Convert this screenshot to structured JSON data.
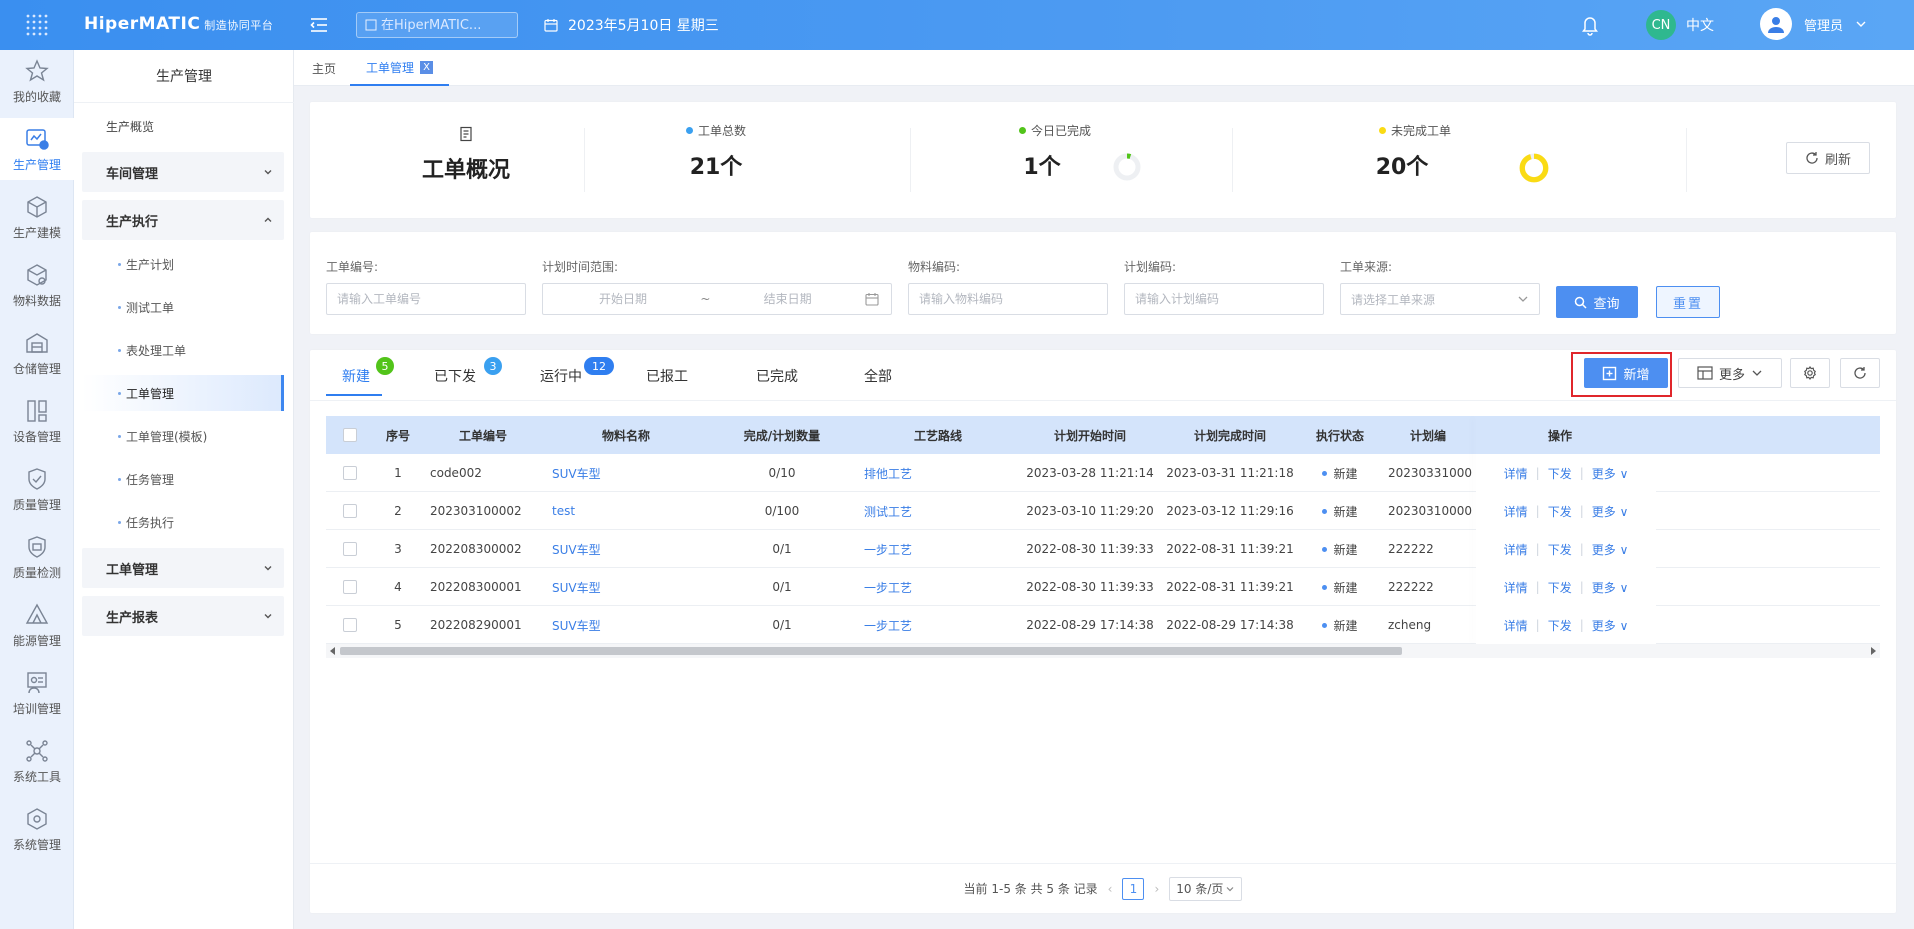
{
  "header": {
    "logo": "HiperMATIC",
    "logo_sub": "制造协同平台",
    "search_placeholder": "在HiperMATIC...",
    "date": "2023年5月10日 星期三",
    "lang_badge": "CN",
    "lang_label": "中文",
    "user_name": "管理员"
  },
  "rail": {
    "items": [
      {
        "label": "我的收藏",
        "icon": "star-icon"
      },
      {
        "label": "生产管理",
        "icon": "production-icon"
      },
      {
        "label": "生产建模",
        "icon": "cube-icon"
      },
      {
        "label": "物料数据",
        "icon": "cube-data-icon"
      },
      {
        "label": "仓储管理",
        "icon": "warehouse-icon"
      },
      {
        "label": "设备管理",
        "icon": "device-icon"
      },
      {
        "label": "质量管理",
        "icon": "shield-icon"
      },
      {
        "label": "质量检测",
        "icon": "shield-check-icon"
      },
      {
        "label": "能源管理",
        "icon": "energy-icon"
      },
      {
        "label": "培训管理",
        "icon": "training-icon"
      },
      {
        "label": "系统工具",
        "icon": "network-icon"
      },
      {
        "label": "系统管理",
        "icon": "settings-cube-icon"
      }
    ]
  },
  "submenu": {
    "title": "生产管理",
    "overview": "生产概览",
    "groups": {
      "workshop": "车间管理",
      "execution": "生产执行",
      "workorder": "工单管理",
      "report": "生产报表"
    },
    "exec_items": [
      "生产计划",
      "测试工单",
      "表处理工单",
      "工单管理",
      "工单管理(模板)",
      "任务管理",
      "任务执行"
    ]
  },
  "pagetabs": {
    "home": "主页",
    "current": "工单管理",
    "close": "X"
  },
  "overview": {
    "title": "工单概况",
    "total_label": "工单总数",
    "total_value": "21个",
    "done_label": "今日已完成",
    "done_value": "1个",
    "undone_label": "未完成工单",
    "undone_value": "20个",
    "done_ratio": 0.05,
    "undone_ratio": 0.95,
    "refresh": "刷新",
    "colors": {
      "total": "#3aa0f0",
      "done": "#52c41a",
      "undone": "#fadb14"
    }
  },
  "filter": {
    "order_no_label": "工单编号:",
    "order_no_placeholder": "请输入工单编号",
    "range_label": "计划时间范围:",
    "start_placeholder": "开始日期",
    "range_sep": "~",
    "end_placeholder": "结束日期",
    "material_label": "物料编码:",
    "material_placeholder": "请输入物料编码",
    "plan_label": "计划编码:",
    "plan_placeholder": "请输入计划编码",
    "source_label": "工单来源:",
    "source_placeholder": "请选择工单来源",
    "query": "查询",
    "reset": "重置"
  },
  "table_tabs": {
    "new": "新建",
    "new_count": "5",
    "issued": "已下发",
    "issued_count": "3",
    "running": "运行中",
    "running_count": "12",
    "reported": "已报工",
    "completed": "已完成",
    "all": "全部",
    "add_button": "新增",
    "more_button": "更多"
  },
  "table": {
    "columns": [
      "序号",
      "工单编号",
      "物料名称",
      "完成/计划数量",
      "工艺路线",
      "计划开始时间",
      "计划完成时间",
      "执行状态",
      "计划编",
      "操作"
    ],
    "rows": [
      {
        "idx": "1",
        "order_no": "code002",
        "material": "SUV车型",
        "qty": "0/10",
        "route": "排他工艺",
        "start": "2023-03-28 11:21:14",
        "end": "2023-03-31 11:21:18",
        "status": "新建",
        "plan": "20230331000"
      },
      {
        "idx": "2",
        "order_no": "202303100002",
        "material": "test",
        "qty": "0/100",
        "route": "测试工艺",
        "start": "2023-03-10 11:29:20",
        "end": "2023-03-12 11:29:16",
        "status": "新建",
        "plan": "20230310000"
      },
      {
        "idx": "3",
        "order_no": "202208300002",
        "material": "SUV车型",
        "qty": "0/1",
        "route": "一步工艺",
        "start": "2022-08-30 11:39:33",
        "end": "2022-08-31 11:39:21",
        "status": "新建",
        "plan": "222222"
      },
      {
        "idx": "4",
        "order_no": "202208300001",
        "material": "SUV车型",
        "qty": "0/1",
        "route": "一步工艺",
        "start": "2022-08-30 11:39:33",
        "end": "2022-08-31 11:39:21",
        "status": "新建",
        "plan": "222222"
      },
      {
        "idx": "5",
        "order_no": "202208290001",
        "material": "SUV车型",
        "qty": "0/1",
        "route": "一步工艺",
        "start": "2022-08-29 17:14:38",
        "end": "2022-08-29 17:14:38",
        "status": "新建",
        "plan": "zcheng"
      }
    ],
    "ops": {
      "detail": "详情",
      "issue": "下发",
      "more": "更多"
    }
  },
  "pager": {
    "summary": "当前 1-5 条 共 5 条 记录",
    "page": "1",
    "size": "10 条/页"
  }
}
